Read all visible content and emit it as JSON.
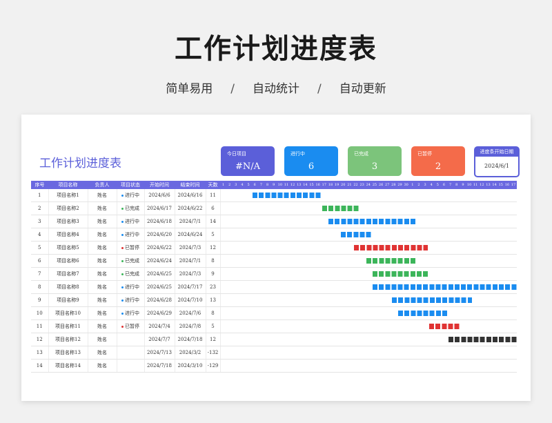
{
  "header": {
    "title": "工作计划进度表",
    "tags": [
      "简单易用",
      "自动统计",
      "自动更新"
    ],
    "separator": "/"
  },
  "sheet": {
    "title": "工作计划进度表",
    "cards": [
      {
        "label": "今日项目",
        "value": "#N/A",
        "color": "#5b5fd9"
      },
      {
        "label": "进行中",
        "value": "6",
        "color": "#1a8cf0"
      },
      {
        "label": "已完成",
        "value": "3",
        "color": "#7cc47b"
      },
      {
        "label": "已暂停",
        "value": "2",
        "color": "#f46b4a"
      }
    ],
    "start_card": {
      "label": "进度条开始日期",
      "value": "2024/6/1"
    },
    "columns": [
      "序号",
      "项目名称",
      "负责人",
      "项目状态",
      "开始时间",
      "结束时间",
      "天数"
    ],
    "days": [
      "1",
      "2",
      "3",
      "4",
      "5",
      "6",
      "7",
      "8",
      "9",
      "10",
      "11",
      "12",
      "13",
      "14",
      "15",
      "16",
      "17",
      "18",
      "19",
      "20",
      "21",
      "22",
      "23",
      "24",
      "25",
      "26",
      "27",
      "28",
      "29",
      "30",
      "1",
      "2",
      "3",
      "4",
      "5",
      "6",
      "7",
      "8",
      "9",
      "10",
      "11",
      "12",
      "13",
      "14",
      "15",
      "16",
      "17"
    ],
    "status_colors": {
      "进行中": "#1a8cf0",
      "已完成": "#3cb55a",
      "已暂停": "#e03333",
      "": "#333333"
    },
    "rows": [
      {
        "no": "1",
        "name": "项目名称1",
        "owner": "姓名",
        "status": "进行中",
        "start": "2024/6/6",
        "end": "2024/6/16",
        "days": "11",
        "bar_start": 6,
        "bar_len": 11
      },
      {
        "no": "2",
        "name": "项目名称2",
        "owner": "姓名",
        "status": "已完成",
        "start": "2024/6/17",
        "end": "2024/6/22",
        "days": "6",
        "bar_start": 17,
        "bar_len": 6
      },
      {
        "no": "3",
        "name": "项目名称3",
        "owner": "姓名",
        "status": "进行中",
        "start": "2024/6/18",
        "end": "2024/7/1",
        "days": "14",
        "bar_start": 18,
        "bar_len": 14
      },
      {
        "no": "4",
        "name": "项目名称4",
        "owner": "姓名",
        "status": "进行中",
        "start": "2024/6/20",
        "end": "2024/6/24",
        "days": "5",
        "bar_start": 20,
        "bar_len": 5
      },
      {
        "no": "5",
        "name": "项目名称5",
        "owner": "姓名",
        "status": "已暂停",
        "start": "2024/6/22",
        "end": "2024/7/3",
        "days": "12",
        "bar_start": 22,
        "bar_len": 12
      },
      {
        "no": "6",
        "name": "项目名称6",
        "owner": "姓名",
        "status": "已完成",
        "start": "2024/6/24",
        "end": "2024/7/1",
        "days": "8",
        "bar_start": 24,
        "bar_len": 8
      },
      {
        "no": "7",
        "name": "项目名称7",
        "owner": "姓名",
        "status": "已完成",
        "start": "2024/6/25",
        "end": "2024/7/3",
        "days": "9",
        "bar_start": 25,
        "bar_len": 9
      },
      {
        "no": "8",
        "name": "项目名称8",
        "owner": "姓名",
        "status": "进行中",
        "start": "2024/6/25",
        "end": "2024/7/17",
        "days": "23",
        "bar_start": 25,
        "bar_len": 23
      },
      {
        "no": "9",
        "name": "项目名称9",
        "owner": "姓名",
        "status": "进行中",
        "start": "2024/6/28",
        "end": "2024/7/10",
        "days": "13",
        "bar_start": 28,
        "bar_len": 13
      },
      {
        "no": "10",
        "name": "项目名称10",
        "owner": "姓名",
        "status": "进行中",
        "start": "2024/6/29",
        "end": "2024/7/6",
        "days": "8",
        "bar_start": 29,
        "bar_len": 8
      },
      {
        "no": "11",
        "name": "项目名称11",
        "owner": "姓名",
        "status": "已暂停",
        "start": "2024/7/4",
        "end": "2024/7/8",
        "days": "5",
        "bar_start": 34,
        "bar_len": 5
      },
      {
        "no": "12",
        "name": "项目名称12",
        "owner": "姓名",
        "status": "",
        "start": "2024/7/7",
        "end": "2024/7/18",
        "days": "12",
        "bar_start": 37,
        "bar_len": 11
      },
      {
        "no": "13",
        "name": "项目名称13",
        "owner": "姓名",
        "status": "",
        "start": "2024/7/13",
        "end": "2024/3/2",
        "days": "-132",
        "bar_start": 0,
        "bar_len": 0
      },
      {
        "no": "14",
        "name": "项目名称14",
        "owner": "姓名",
        "status": "",
        "start": "2024/7/18",
        "end": "2024/3/10",
        "days": "-129",
        "bar_start": 0,
        "bar_len": 0
      }
    ]
  }
}
